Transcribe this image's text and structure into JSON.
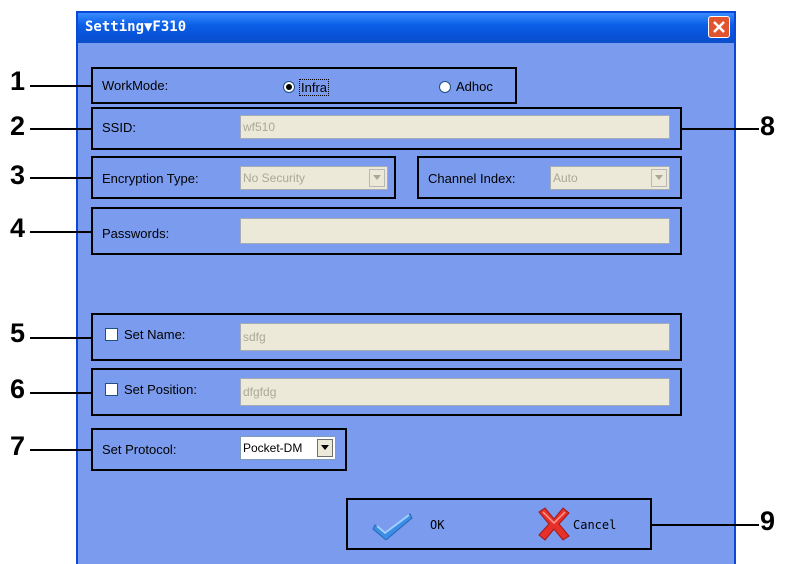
{
  "window": {
    "title": "Setting▼F310"
  },
  "workmode": {
    "label": "WorkMode:",
    "options": [
      "Infra",
      "Adhoc"
    ],
    "selected": "Infra"
  },
  "ssid": {
    "label": "SSID:",
    "value": "wf510"
  },
  "encryption": {
    "label": "Encryption Type:",
    "value": "No Security"
  },
  "channel": {
    "label": "Channel Index:",
    "value": "Auto"
  },
  "passwords": {
    "label": "Passwords:",
    "value": ""
  },
  "set_name": {
    "label": "Set Name:",
    "value": "sdfg",
    "checked": false
  },
  "set_position": {
    "label": "Set Position:",
    "value": "dfgfdg",
    "checked": false
  },
  "protocol": {
    "label": "Set Protocol:",
    "value": "Pocket-DM"
  },
  "buttons": {
    "ok": "OK",
    "cancel": "Cancel"
  },
  "callouts": [
    "1",
    "2",
    "3",
    "4",
    "5",
    "6",
    "7",
    "8",
    "9"
  ],
  "colors": {
    "dialog_bg": "#7b9bee",
    "titlebar": "#0a5fe6",
    "close": "#e2542f",
    "field_bg": "#ece9d8"
  }
}
